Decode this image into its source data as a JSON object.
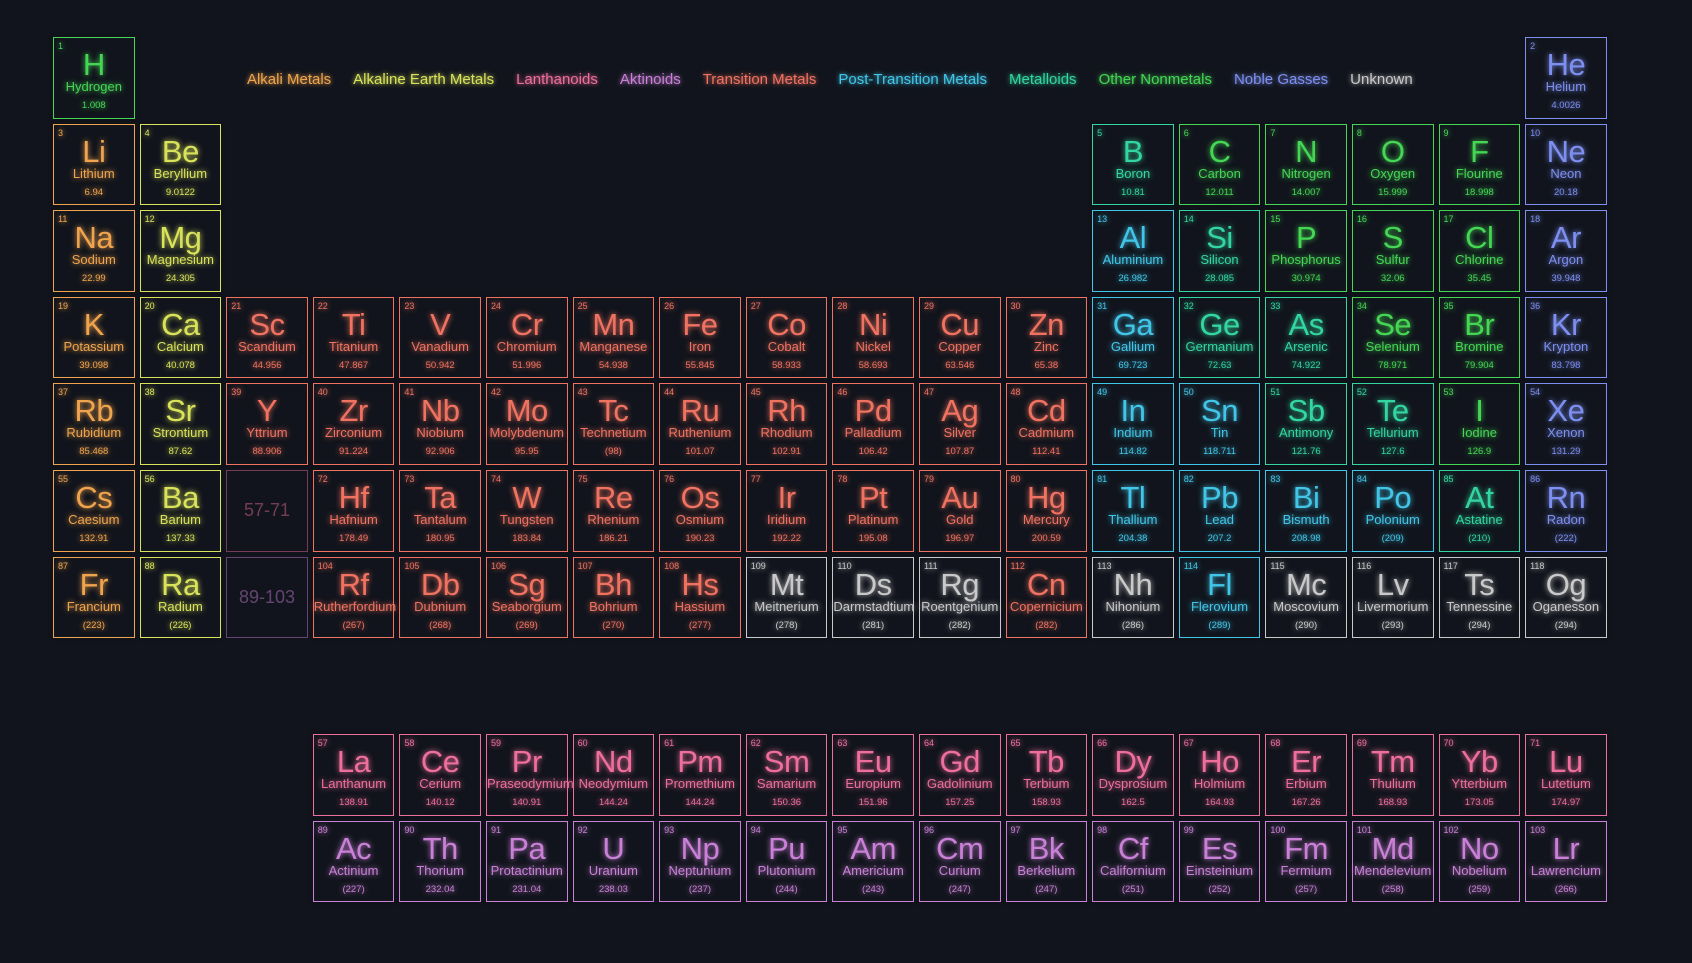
{
  "legend": [
    {
      "key": "alkali",
      "label": "Alkali Metals"
    },
    {
      "key": "alkaline",
      "label": "Alkaline Earth Metals"
    },
    {
      "key": "lanth",
      "label": "Lanthanoids"
    },
    {
      "key": "act",
      "label": "Aktinoids"
    },
    {
      "key": "trans",
      "label": "Transition Metals"
    },
    {
      "key": "post",
      "label": "Post-Transition Metals"
    },
    {
      "key": "metalloid",
      "label": "Metalloids"
    },
    {
      "key": "nonmetal",
      "label": "Other Nonmetals"
    },
    {
      "key": "noble",
      "label": "Noble Gasses"
    },
    {
      "key": "unknown",
      "label": "Unknown"
    }
  ],
  "colors": {
    "background": "#11141c",
    "alkali": "#f0a44d",
    "alkaline": "#d8e25a",
    "lanth": "#ee6e9c",
    "act": "#c980d6",
    "trans": "#f07260",
    "post": "#42c6e8",
    "metalloid": "#33d6a0",
    "nonmetal": "#45d654",
    "noble": "#7d8ff0",
    "unknown": "#c9c9c9"
  },
  "placeholders": [
    {
      "label": "57-71",
      "category": "lanth",
      "row": 6,
      "col": 3
    },
    {
      "label": "89-103",
      "category": "act",
      "row": 7,
      "col": 3
    }
  ],
  "elements": [
    {
      "n": "1",
      "s": "H",
      "name": "Hydrogen",
      "m": "1.008",
      "c": "nonmetal",
      "r": 1,
      "g": 1
    },
    {
      "n": "2",
      "s": "He",
      "name": "Helium",
      "m": "4.0026",
      "c": "noble",
      "r": 1,
      "g": 18
    },
    {
      "n": "3",
      "s": "Li",
      "name": "Lithium",
      "m": "6.94",
      "c": "alkali",
      "r": 2,
      "g": 1
    },
    {
      "n": "4",
      "s": "Be",
      "name": "Beryllium",
      "m": "9.0122",
      "c": "alkaline",
      "r": 2,
      "g": 2
    },
    {
      "n": "5",
      "s": "B",
      "name": "Boron",
      "m": "10.81",
      "c": "metalloid",
      "r": 2,
      "g": 13
    },
    {
      "n": "6",
      "s": "C",
      "name": "Carbon",
      "m": "12.011",
      "c": "nonmetal",
      "r": 2,
      "g": 14
    },
    {
      "n": "7",
      "s": "N",
      "name": "Nitrogen",
      "m": "14.007",
      "c": "nonmetal",
      "r": 2,
      "g": 15
    },
    {
      "n": "8",
      "s": "O",
      "name": "Oxygen",
      "m": "15.999",
      "c": "nonmetal",
      "r": 2,
      "g": 16
    },
    {
      "n": "9",
      "s": "F",
      "name": "Flourine",
      "m": "18.998",
      "c": "nonmetal",
      "r": 2,
      "g": 17
    },
    {
      "n": "10",
      "s": "Ne",
      "name": "Neon",
      "m": "20.18",
      "c": "noble",
      "r": 2,
      "g": 18
    },
    {
      "n": "11",
      "s": "Na",
      "name": "Sodium",
      "m": "22.99",
      "c": "alkali",
      "r": 3,
      "g": 1
    },
    {
      "n": "12",
      "s": "Mg",
      "name": "Magnesium",
      "m": "24.305",
      "c": "alkaline",
      "r": 3,
      "g": 2
    },
    {
      "n": "13",
      "s": "Al",
      "name": "Aluminium",
      "m": "26.982",
      "c": "post",
      "r": 3,
      "g": 13
    },
    {
      "n": "14",
      "s": "Si",
      "name": "Silicon",
      "m": "28.085",
      "c": "metalloid",
      "r": 3,
      "g": 14
    },
    {
      "n": "15",
      "s": "P",
      "name": "Phosphorus",
      "m": "30.974",
      "c": "nonmetal",
      "r": 3,
      "g": 15
    },
    {
      "n": "16",
      "s": "S",
      "name": "Sulfur",
      "m": "32.06",
      "c": "nonmetal",
      "r": 3,
      "g": 16
    },
    {
      "n": "17",
      "s": "Cl",
      "name": "Chlorine",
      "m": "35.45",
      "c": "nonmetal",
      "r": 3,
      "g": 17
    },
    {
      "n": "18",
      "s": "Ar",
      "name": "Argon",
      "m": "39.948",
      "c": "noble",
      "r": 3,
      "g": 18
    },
    {
      "n": "19",
      "s": "K",
      "name": "Potassium",
      "m": "39.098",
      "c": "alkali",
      "r": 4,
      "g": 1
    },
    {
      "n": "20",
      "s": "Ca",
      "name": "Calcium",
      "m": "40.078",
      "c": "alkaline",
      "r": 4,
      "g": 2
    },
    {
      "n": "21",
      "s": "Sc",
      "name": "Scandium",
      "m": "44.956",
      "c": "trans",
      "r": 4,
      "g": 3
    },
    {
      "n": "22",
      "s": "Ti",
      "name": "Titanium",
      "m": "47.867",
      "c": "trans",
      "r": 4,
      "g": 4
    },
    {
      "n": "23",
      "s": "V",
      "name": "Vanadium",
      "m": "50.942",
      "c": "trans",
      "r": 4,
      "g": 5
    },
    {
      "n": "24",
      "s": "Cr",
      "name": "Chromium",
      "m": "51.996",
      "c": "trans",
      "r": 4,
      "g": 6
    },
    {
      "n": "25",
      "s": "Mn",
      "name": "Manganese",
      "m": "54.938",
      "c": "trans",
      "r": 4,
      "g": 7
    },
    {
      "n": "26",
      "s": "Fe",
      "name": "Iron",
      "m": "55.845",
      "c": "trans",
      "r": 4,
      "g": 8
    },
    {
      "n": "27",
      "s": "Co",
      "name": "Cobalt",
      "m": "58.933",
      "c": "trans",
      "r": 4,
      "g": 9
    },
    {
      "n": "28",
      "s": "Ni",
      "name": "Nickel",
      "m": "58.693",
      "c": "trans",
      "r": 4,
      "g": 10
    },
    {
      "n": "29",
      "s": "Cu",
      "name": "Copper",
      "m": "63.546",
      "c": "trans",
      "r": 4,
      "g": 11
    },
    {
      "n": "30",
      "s": "Zn",
      "name": "Zinc",
      "m": "65.38",
      "c": "trans",
      "r": 4,
      "g": 12
    },
    {
      "n": "31",
      "s": "Ga",
      "name": "Gallium",
      "m": "69.723",
      "c": "post",
      "r": 4,
      "g": 13
    },
    {
      "n": "32",
      "s": "Ge",
      "name": "Germanium",
      "m": "72.63",
      "c": "metalloid",
      "r": 4,
      "g": 14
    },
    {
      "n": "33",
      "s": "As",
      "name": "Arsenic",
      "m": "74.922",
      "c": "metalloid",
      "r": 4,
      "g": 15
    },
    {
      "n": "34",
      "s": "Se",
      "name": "Selenium",
      "m": "78.971",
      "c": "nonmetal",
      "r": 4,
      "g": 16
    },
    {
      "n": "35",
      "s": "Br",
      "name": "Bromine",
      "m": "79.904",
      "c": "nonmetal",
      "r": 4,
      "g": 17
    },
    {
      "n": "36",
      "s": "Kr",
      "name": "Krypton",
      "m": "83.798",
      "c": "noble",
      "r": 4,
      "g": 18
    },
    {
      "n": "37",
      "s": "Rb",
      "name": "Rubidium",
      "m": "85.468",
      "c": "alkali",
      "r": 5,
      "g": 1
    },
    {
      "n": "38",
      "s": "Sr",
      "name": "Strontium",
      "m": "87.62",
      "c": "alkaline",
      "r": 5,
      "g": 2
    },
    {
      "n": "39",
      "s": "Y",
      "name": "Yttrium",
      "m": "88.906",
      "c": "trans",
      "r": 5,
      "g": 3
    },
    {
      "n": "40",
      "s": "Zr",
      "name": "Zirconium",
      "m": "91.224",
      "c": "trans",
      "r": 5,
      "g": 4
    },
    {
      "n": "41",
      "s": "Nb",
      "name": "Niobium",
      "m": "92.906",
      "c": "trans",
      "r": 5,
      "g": 5
    },
    {
      "n": "42",
      "s": "Mo",
      "name": "Molybdenum",
      "m": "95.95",
      "c": "trans",
      "r": 5,
      "g": 6
    },
    {
      "n": "43",
      "s": "Tc",
      "name": "Technetium",
      "m": "(98)",
      "c": "trans",
      "r": 5,
      "g": 7
    },
    {
      "n": "44",
      "s": "Ru",
      "name": "Ruthenium",
      "m": "101.07",
      "c": "trans",
      "r": 5,
      "g": 8
    },
    {
      "n": "45",
      "s": "Rh",
      "name": "Rhodium",
      "m": "102.91",
      "c": "trans",
      "r": 5,
      "g": 9
    },
    {
      "n": "46",
      "s": "Pd",
      "name": "Palladium",
      "m": "106.42",
      "c": "trans",
      "r": 5,
      "g": 10
    },
    {
      "n": "47",
      "s": "Ag",
      "name": "Silver",
      "m": "107.87",
      "c": "trans",
      "r": 5,
      "g": 11
    },
    {
      "n": "48",
      "s": "Cd",
      "name": "Cadmium",
      "m": "112.41",
      "c": "trans",
      "r": 5,
      "g": 12
    },
    {
      "n": "49",
      "s": "In",
      "name": "Indium",
      "m": "114.82",
      "c": "post",
      "r": 5,
      "g": 13
    },
    {
      "n": "50",
      "s": "Sn",
      "name": "Tin",
      "m": "118.711",
      "c": "post",
      "r": 5,
      "g": 14
    },
    {
      "n": "51",
      "s": "Sb",
      "name": "Antimony",
      "m": "121.76",
      "c": "metalloid",
      "r": 5,
      "g": 15
    },
    {
      "n": "52",
      "s": "Te",
      "name": "Tellurium",
      "m": "127.6",
      "c": "metalloid",
      "r": 5,
      "g": 16
    },
    {
      "n": "53",
      "s": "I",
      "name": "Iodine",
      "m": "126.9",
      "c": "nonmetal",
      "r": 5,
      "g": 17
    },
    {
      "n": "54",
      "s": "Xe",
      "name": "Xenon",
      "m": "131.29",
      "c": "noble",
      "r": 5,
      "g": 18
    },
    {
      "n": "55",
      "s": "Cs",
      "name": "Caesium",
      "m": "132.91",
      "c": "alkali",
      "r": 6,
      "g": 1
    },
    {
      "n": "56",
      "s": "Ba",
      "name": "Barium",
      "m": "137.33",
      "c": "alkaline",
      "r": 6,
      "g": 2
    },
    {
      "n": "72",
      "s": "Hf",
      "name": "Hafnium",
      "m": "178.49",
      "c": "trans",
      "r": 6,
      "g": 4
    },
    {
      "n": "73",
      "s": "Ta",
      "name": "Tantalum",
      "m": "180.95",
      "c": "trans",
      "r": 6,
      "g": 5
    },
    {
      "n": "74",
      "s": "W",
      "name": "Tungsten",
      "m": "183.84",
      "c": "trans",
      "r": 6,
      "g": 6
    },
    {
      "n": "75",
      "s": "Re",
      "name": "Rhenium",
      "m": "186.21",
      "c": "trans",
      "r": 6,
      "g": 7
    },
    {
      "n": "76",
      "s": "Os",
      "name": "Osmium",
      "m": "190.23",
      "c": "trans",
      "r": 6,
      "g": 8
    },
    {
      "n": "77",
      "s": "Ir",
      "name": "Iridium",
      "m": "192.22",
      "c": "trans",
      "r": 6,
      "g": 9
    },
    {
      "n": "78",
      "s": "Pt",
      "name": "Platinum",
      "m": "195.08",
      "c": "trans",
      "r": 6,
      "g": 10
    },
    {
      "n": "79",
      "s": "Au",
      "name": "Gold",
      "m": "196.97",
      "c": "trans",
      "r": 6,
      "g": 11
    },
    {
      "n": "80",
      "s": "Hg",
      "name": "Mercury",
      "m": "200.59",
      "c": "trans",
      "r": 6,
      "g": 12
    },
    {
      "n": "81",
      "s": "Tl",
      "name": "Thallium",
      "m": "204.38",
      "c": "post",
      "r": 6,
      "g": 13
    },
    {
      "n": "82",
      "s": "Pb",
      "name": "Lead",
      "m": "207.2",
      "c": "post",
      "r": 6,
      "g": 14
    },
    {
      "n": "83",
      "s": "Bi",
      "name": "Bismuth",
      "m": "208.98",
      "c": "post",
      "r": 6,
      "g": 15
    },
    {
      "n": "84",
      "s": "Po",
      "name": "Polonium",
      "m": "(209)",
      "c": "post",
      "r": 6,
      "g": 16
    },
    {
      "n": "85",
      "s": "At",
      "name": "Astatine",
      "m": "(210)",
      "c": "metalloid",
      "r": 6,
      "g": 17
    },
    {
      "n": "86",
      "s": "Rn",
      "name": "Radon",
      "m": "(222)",
      "c": "noble",
      "r": 6,
      "g": 18
    },
    {
      "n": "87",
      "s": "Fr",
      "name": "Francium",
      "m": "(223)",
      "c": "alkali",
      "r": 7,
      "g": 1
    },
    {
      "n": "88",
      "s": "Ra",
      "name": "Radium",
      "m": "(226)",
      "c": "alkaline",
      "r": 7,
      "g": 2
    },
    {
      "n": "104",
      "s": "Rf",
      "name": "Rutherfordium",
      "m": "(267)",
      "c": "trans",
      "r": 7,
      "g": 4
    },
    {
      "n": "105",
      "s": "Db",
      "name": "Dubnium",
      "m": "(268)",
      "c": "trans",
      "r": 7,
      "g": 5
    },
    {
      "n": "106",
      "s": "Sg",
      "name": "Seaborgium",
      "m": "(269)",
      "c": "trans",
      "r": 7,
      "g": 6
    },
    {
      "n": "107",
      "s": "Bh",
      "name": "Bohrium",
      "m": "(270)",
      "c": "trans",
      "r": 7,
      "g": 7
    },
    {
      "n": "108",
      "s": "Hs",
      "name": "Hassium",
      "m": "(277)",
      "c": "trans",
      "r": 7,
      "g": 8
    },
    {
      "n": "109",
      "s": "Mt",
      "name": "Meitnerium",
      "m": "(278)",
      "c": "unknown",
      "r": 7,
      "g": 9
    },
    {
      "n": "110",
      "s": "Ds",
      "name": "Darmstadtium",
      "m": "(281)",
      "c": "unknown",
      "r": 7,
      "g": 10
    },
    {
      "n": "111",
      "s": "Rg",
      "name": "Roentgenium",
      "m": "(282)",
      "c": "unknown",
      "r": 7,
      "g": 11
    },
    {
      "n": "112",
      "s": "Cn",
      "name": "Copernicium",
      "m": "(282)",
      "c": "trans",
      "r": 7,
      "g": 12
    },
    {
      "n": "113",
      "s": "Nh",
      "name": "Nihonium",
      "m": "(286)",
      "c": "unknown",
      "r": 7,
      "g": 13
    },
    {
      "n": "114",
      "s": "Fl",
      "name": "Flerovium",
      "m": "(289)",
      "c": "post",
      "r": 7,
      "g": 14
    },
    {
      "n": "115",
      "s": "Mc",
      "name": "Moscovium",
      "m": "(290)",
      "c": "unknown",
      "r": 7,
      "g": 15
    },
    {
      "n": "116",
      "s": "Lv",
      "name": "Livermorium",
      "m": "(293)",
      "c": "unknown",
      "r": 7,
      "g": 16
    },
    {
      "n": "117",
      "s": "Ts",
      "name": "Tennessine",
      "m": "(294)",
      "c": "unknown",
      "r": 7,
      "g": 17
    },
    {
      "n": "118",
      "s": "Og",
      "name": "Oganesson",
      "m": "(294)",
      "c": "unknown",
      "r": 7,
      "g": 18
    },
    {
      "n": "57",
      "s": "La",
      "name": "Lanthanum",
      "m": "138.91",
      "c": "lanth",
      "r": 9,
      "g": 4
    },
    {
      "n": "58",
      "s": "Ce",
      "name": "Cerium",
      "m": "140.12",
      "c": "lanth",
      "r": 9,
      "g": 5
    },
    {
      "n": "59",
      "s": "Pr",
      "name": "Praseodymium",
      "m": "140.91",
      "c": "lanth",
      "r": 9,
      "g": 6
    },
    {
      "n": "60",
      "s": "Nd",
      "name": "Neodymium",
      "m": "144.24",
      "c": "lanth",
      "r": 9,
      "g": 7
    },
    {
      "n": "61",
      "s": "Pm",
      "name": "Promethium",
      "m": "144.24",
      "c": "lanth",
      "r": 9,
      "g": 8
    },
    {
      "n": "62",
      "s": "Sm",
      "name": "Samarium",
      "m": "150.36",
      "c": "lanth",
      "r": 9,
      "g": 9
    },
    {
      "n": "63",
      "s": "Eu",
      "name": "Europium",
      "m": "151.96",
      "c": "lanth",
      "r": 9,
      "g": 10
    },
    {
      "n": "64",
      "s": "Gd",
      "name": "Gadolinium",
      "m": "157.25",
      "c": "lanth",
      "r": 9,
      "g": 11
    },
    {
      "n": "65",
      "s": "Tb",
      "name": "Terbium",
      "m": "158.93",
      "c": "lanth",
      "r": 9,
      "g": 12
    },
    {
      "n": "66",
      "s": "Dy",
      "name": "Dysprosium",
      "m": "162.5",
      "c": "lanth",
      "r": 9,
      "g": 13
    },
    {
      "n": "67",
      "s": "Ho",
      "name": "Holmium",
      "m": "164.93",
      "c": "lanth",
      "r": 9,
      "g": 14
    },
    {
      "n": "68",
      "s": "Er",
      "name": "Erbium",
      "m": "167.26",
      "c": "lanth",
      "r": 9,
      "g": 15
    },
    {
      "n": "69",
      "s": "Tm",
      "name": "Thulium",
      "m": "168.93",
      "c": "lanth",
      "r": 9,
      "g": 16
    },
    {
      "n": "70",
      "s": "Yb",
      "name": "Ytterbium",
      "m": "173.05",
      "c": "lanth",
      "r": 9,
      "g": 17
    },
    {
      "n": "71",
      "s": "Lu",
      "name": "Lutetium",
      "m": "174.97",
      "c": "lanth",
      "r": 9,
      "g": 18
    },
    {
      "n": "89",
      "s": "Ac",
      "name": "Actinium",
      "m": "(227)",
      "c": "act",
      "r": 10,
      "g": 4
    },
    {
      "n": "90",
      "s": "Th",
      "name": "Thorium",
      "m": "232.04",
      "c": "act",
      "r": 10,
      "g": 5
    },
    {
      "n": "91",
      "s": "Pa",
      "name": "Protactinium",
      "m": "231.04",
      "c": "act",
      "r": 10,
      "g": 6
    },
    {
      "n": "92",
      "s": "U",
      "name": "Uranium",
      "m": "238.03",
      "c": "act",
      "r": 10,
      "g": 7
    },
    {
      "n": "93",
      "s": "Np",
      "name": "Neptunium",
      "m": "(237)",
      "c": "act",
      "r": 10,
      "g": 8
    },
    {
      "n": "94",
      "s": "Pu",
      "name": "Plutonium",
      "m": "(244)",
      "c": "act",
      "r": 10,
      "g": 9
    },
    {
      "n": "95",
      "s": "Am",
      "name": "Americium",
      "m": "(243)",
      "c": "act",
      "r": 10,
      "g": 10
    },
    {
      "n": "96",
      "s": "Cm",
      "name": "Curium",
      "m": "(247)",
      "c": "act",
      "r": 10,
      "g": 11
    },
    {
      "n": "97",
      "s": "Bk",
      "name": "Berkelium",
      "m": "(247)",
      "c": "act",
      "r": 10,
      "g": 12
    },
    {
      "n": "98",
      "s": "Cf",
      "name": "Californium",
      "m": "(251)",
      "c": "act",
      "r": 10,
      "g": 13
    },
    {
      "n": "99",
      "s": "Es",
      "name": "Einsteinium",
      "m": "(252)",
      "c": "act",
      "r": 10,
      "g": 14
    },
    {
      "n": "100",
      "s": "Fm",
      "name": "Fermium",
      "m": "(257)",
      "c": "act",
      "r": 10,
      "g": 15
    },
    {
      "n": "101",
      "s": "Md",
      "name": "Mendelevium",
      "m": "(258)",
      "c": "act",
      "r": 10,
      "g": 16
    },
    {
      "n": "102",
      "s": "No",
      "name": "Nobelium",
      "m": "(259)",
      "c": "act",
      "r": 10,
      "g": 17
    },
    {
      "n": "103",
      "s": "Lr",
      "name": "Lawrencium",
      "m": "(266)",
      "c": "act",
      "r": 10,
      "g": 18
    }
  ]
}
